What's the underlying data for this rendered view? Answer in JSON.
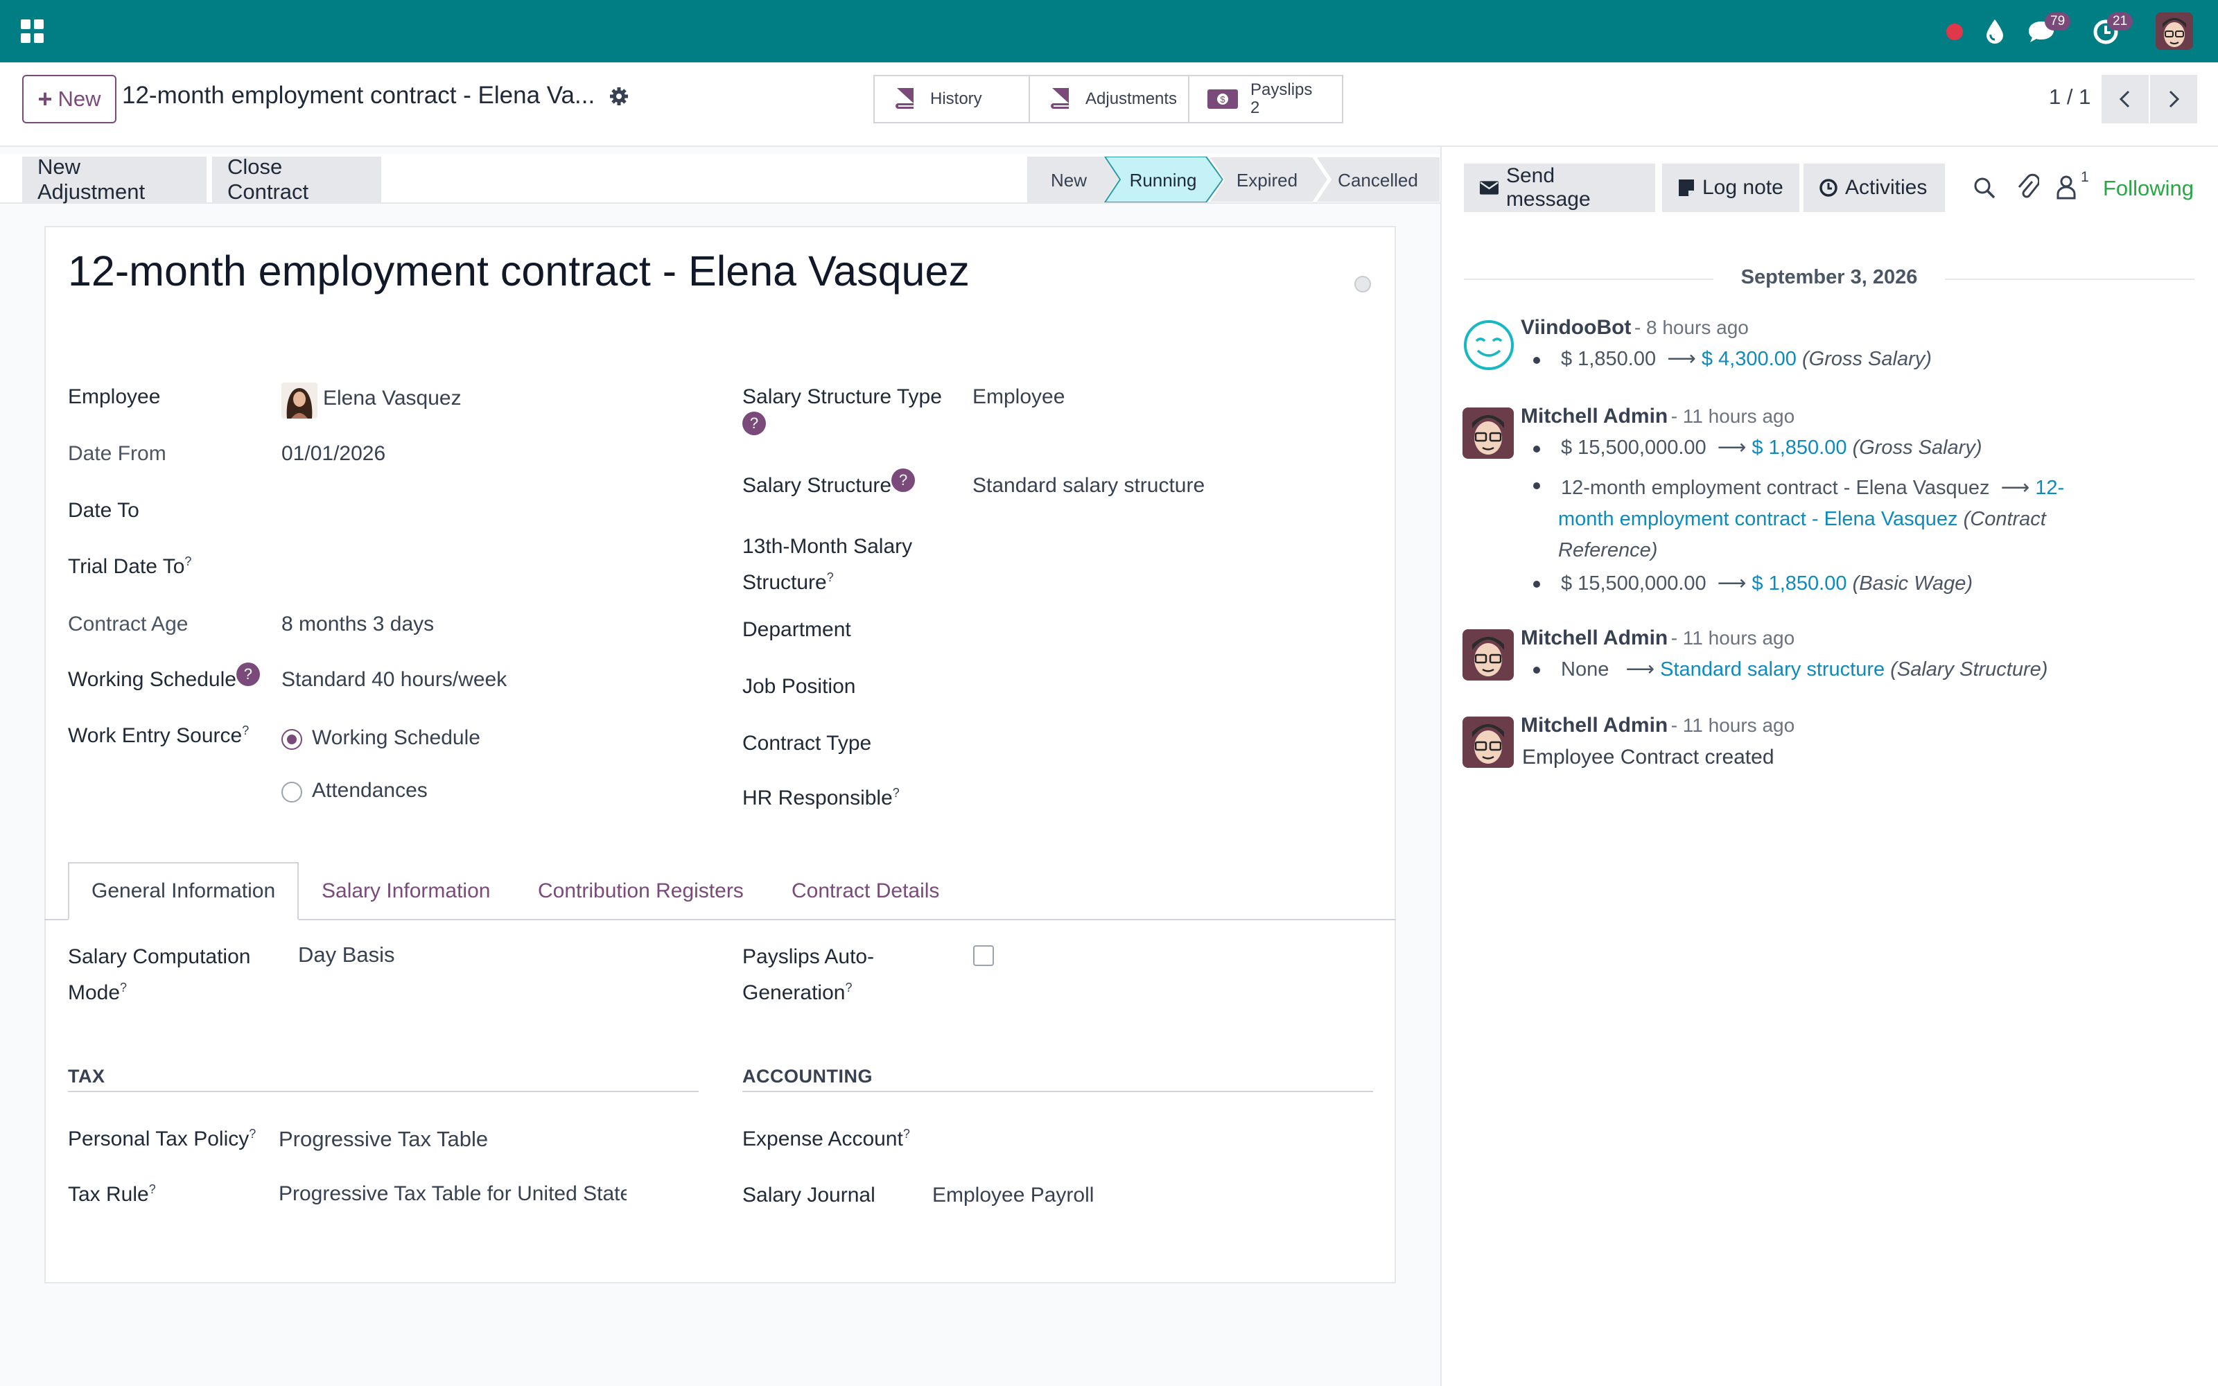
{
  "navbar": {
    "messages_count": "79",
    "activities_count": "21"
  },
  "control_panel": {
    "new_label": "New",
    "breadcrumb": "12-month employment contract - Elena Va...",
    "smart_buttons": {
      "history": "History",
      "adjustments": "Adjustments",
      "payslips": "Payslips",
      "payslips_count": "2"
    },
    "pager": "1 / 1"
  },
  "header": {
    "new_adjustment": "New Adjustment",
    "close_contract": "Close Contract",
    "stages": [
      "New",
      "Running",
      "Expired",
      "Cancelled"
    ],
    "active_stage": "Running"
  },
  "form": {
    "title": "12-month employment contract - Elena Vasquez",
    "left": {
      "employee_label": "Employee",
      "employee_value": "Elena Vasquez",
      "date_from_label": "Date From",
      "date_from_value": "01/01/2026",
      "date_to_label": "Date To",
      "trial_date_label": "Trial Date To",
      "contract_age_label": "Contract Age",
      "contract_age_value": "8 months 3 days",
      "working_schedule_label": "Working Schedule",
      "working_schedule_value": "Standard 40 hours/week",
      "work_entry_label": "Work Entry Source",
      "work_entry_options": [
        "Working Schedule",
        "Attendances"
      ],
      "work_entry_selected": "Working Schedule"
    },
    "right": {
      "structure_type_label": "Salary Structure Type",
      "structure_type_value": "Employee",
      "structure_label": "Salary Structure",
      "structure_value": "Standard salary structure",
      "thirteenth_label_1": "13th-Month Salary",
      "thirteenth_label_2": "Structure",
      "department_label": "Department",
      "job_label": "Job Position",
      "contract_type_label": "Contract Type",
      "hr_label": "HR Responsible"
    },
    "tabs": [
      "General Information",
      "Salary Information",
      "Contribution Registers",
      "Contract Details"
    ],
    "active_tab": "General Information",
    "general": {
      "computation_label_1": "Salary Computation",
      "computation_label_2": "Mode",
      "computation_value": "Day Basis",
      "auto_gen_label_1": "Payslips Auto-",
      "auto_gen_label_2": "Generation",
      "auto_gen_checked": false,
      "tax_section": "TAX",
      "accounting_section": "ACCOUNTING",
      "tax_policy_label": "Personal Tax Policy",
      "tax_policy_value": "Progressive Tax Table",
      "tax_rule_label": "Tax Rule",
      "tax_rule_value": "Progressive Tax Table for United State",
      "expense_label": "Expense Account",
      "journal_label": "Salary Journal",
      "journal_value": "Employee Payroll"
    },
    "help_mark": "?"
  },
  "chatter": {
    "send_message": "Send message",
    "log_note": "Log note",
    "activities": "Activities",
    "followers_count": "1",
    "following": "Following",
    "date": "September 3, 2026",
    "messages": [
      {
        "author": "ViindooBot",
        "ago": "- 8 hours ago",
        "changes": [
          {
            "old": "$ 1,850.00",
            "new": "$ 4,300.00",
            "field": "(Gross Salary)"
          }
        ]
      },
      {
        "author": "Mitchell Admin",
        "ago": "- 11 hours ago",
        "changes": [
          {
            "old": "$ 15,500,000.00",
            "new": "$ 1,850.00",
            "field": "(Gross Salary)"
          },
          {
            "old": "12-month employment contract - Elena Vasquez",
            "new_1": "12-",
            "new_2": "month employment contract - Elena Vasquez",
            "field_1": "(Contract",
            "field_2": "Reference)"
          },
          {
            "old": "$ 15,500,000.00",
            "new": "$ 1,850.00",
            "field": "(Basic Wage)"
          }
        ]
      },
      {
        "author": "Mitchell Admin",
        "ago": "- 11 hours ago",
        "changes": [
          {
            "old": "None",
            "new": "Standard salary structure",
            "field": "(Salary Structure)"
          }
        ]
      },
      {
        "author": "Mitchell Admin",
        "ago": "- 11 hours ago",
        "body": "Employee Contract created"
      }
    ]
  },
  "colors": {
    "navbar": "#017e84",
    "brand": "#7a4a7b",
    "link": "#0d8bbf",
    "following": "#28a745",
    "active_stage": "#c5f2f7"
  }
}
